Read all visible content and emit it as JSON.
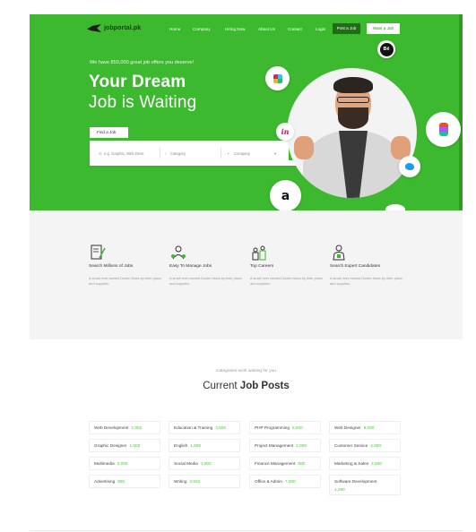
{
  "header": {
    "logo_text": "jobportal.pk",
    "nav": [
      "Home",
      "Company",
      "Hiring Now",
      "About Us",
      "Contact",
      "Login"
    ],
    "post_job": "Post a Job",
    "want_job": "Want a Job"
  },
  "hero": {
    "tagline": "We have 850,000 great job offers you deserve!",
    "title_bold": "Your Dream",
    "title_light": "Job is Waiting",
    "find_tab": "Find a Job",
    "search": {
      "keyword_placeholder": "e.g. Garphic, Web Deve",
      "category_placeholder": "Category",
      "company_placeholder": "Company",
      "button": "Search"
    },
    "bubbles": [
      "behance-icon",
      "slack-icon",
      "invision-icon",
      "figma-icon",
      "twitter-icon",
      "amazon-icon"
    ],
    "behance_text": "Bē",
    "invision_text": "in",
    "amazon_text": "a"
  },
  "features": [
    {
      "icon": "document-pen-icon",
      "title": "Search Millions of Jobs",
      "desc": "A small river named Duden flows by their place and supplies."
    },
    {
      "icon": "team-manage-icon",
      "title": "Easy To Manage Jobs",
      "desc": "A small river named Duden flows by their place and supplies."
    },
    {
      "icon": "career-people-icon",
      "title": "Top Careers",
      "desc": "A small river named Duden flows by their place and supplies."
    },
    {
      "icon": "expert-person-icon",
      "title": "Search Expert Candidates",
      "desc": "A small river named Duden flows by their place and supplies."
    }
  ],
  "categories": {
    "subtitle": "Categories work waiting for you",
    "title_light": "Current",
    "title_bold": "Job Posts",
    "items": [
      {
        "name": "Web Development",
        "count": "1,002"
      },
      {
        "name": "Education & Training",
        "count": "3,500"
      },
      {
        "name": "PHP Programming",
        "count": "5,500"
      },
      {
        "name": "Web Designer",
        "count": "8,000"
      },
      {
        "name": "Graphic Designer",
        "count": "1,002"
      },
      {
        "name": "English",
        "count": "1,500"
      },
      {
        "name": "Project Management",
        "count": "2,000"
      },
      {
        "name": "Customer Service",
        "count": "4,000"
      },
      {
        "name": "Multimedia",
        "count": "2,000"
      },
      {
        "name": "Social Media",
        "count": "1,002"
      },
      {
        "name": "Finance Management",
        "count": "800"
      },
      {
        "name": "Marketing & Sales",
        "count": "3,500"
      },
      {
        "name": "Advertising",
        "count": "800"
      },
      {
        "name": "Writing",
        "count": "2,532"
      },
      {
        "name": "Office & Admin",
        "count": "7,000"
      },
      {
        "name": "Software Development",
        "count": "1,290"
      }
    ]
  },
  "colors": {
    "brand_green": "#3cb92e",
    "dark_green": "#1f6e16",
    "count_green": "#52c245"
  }
}
